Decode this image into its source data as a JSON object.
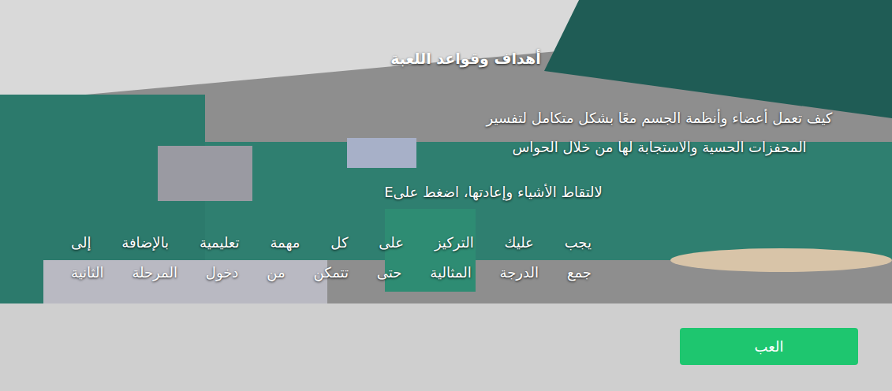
{
  "title": "أهداف وقواعد اللعبة",
  "paragraphs": [
    {
      "lines": [
        "كيف تعمل أعضاء وأنظمة الجسم معًا بشكل متكامل لتفسير",
        "المحفزات الحسية والاستجابة لها من خلال الحواس"
      ]
    },
    {
      "lines": [
        "لالتقاط الأشياء وإعادتها، اضغط علىE"
      ]
    },
    {
      "lines": [
        "يجب عليك التركيز على كل مهمة تعليمية بالإضافة إلى",
        "جمع الدرجة المثالية حتى تتمكن من دخول المرحلة الثانية"
      ]
    }
  ],
  "play_button": {
    "label": "العب"
  }
}
